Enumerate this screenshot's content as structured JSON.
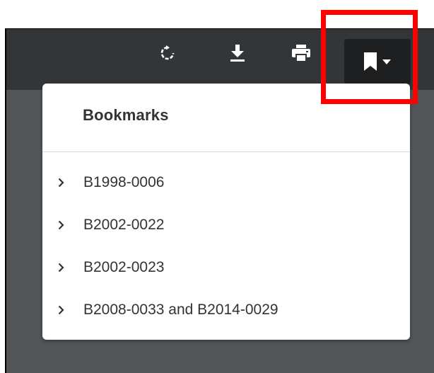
{
  "toolbar": {
    "buttons": [
      {
        "name": "rotate",
        "icon": "rotate-icon"
      },
      {
        "name": "download",
        "icon": "download-icon"
      },
      {
        "name": "print",
        "icon": "print-icon"
      },
      {
        "name": "bookmarks",
        "icon": "bookmark-icon",
        "dropdown": true,
        "state": "open"
      }
    ]
  },
  "bookmarks_menu": {
    "title": "Bookmarks",
    "items": [
      {
        "label": "B1998-0006"
      },
      {
        "label": "B2002-0022"
      },
      {
        "label": "B2002-0023"
      },
      {
        "label": "B2008-0033 and B2014-0029"
      }
    ]
  },
  "colors": {
    "toolbar_bg": "#323639",
    "viewer_bg": "#525659",
    "active_button_bg": "#1d1f21",
    "menu_bg": "#ffffff",
    "highlight": "#ff0000"
  }
}
